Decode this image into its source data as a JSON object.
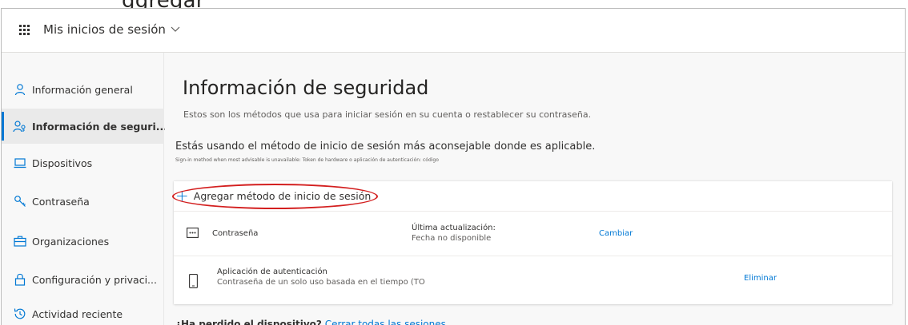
{
  "header_crop": "ggregar",
  "topbar": {
    "title": "Mis inicios de sesión"
  },
  "sidebar": {
    "items": [
      {
        "label": "Información general",
        "icon": "person-icon"
      },
      {
        "label": "Información de seguri...",
        "icon": "security-info-icon",
        "active": true
      },
      {
        "label": "Dispositivos",
        "icon": "laptop-icon"
      },
      {
        "label": "Contraseña",
        "icon": "key-icon"
      },
      {
        "label": "Organizaciones",
        "icon": "briefcase-icon"
      },
      {
        "label": "Configuración y privaci...",
        "icon": "lock-icon"
      },
      {
        "label": "Actividad reciente",
        "icon": "history-icon"
      }
    ]
  },
  "main": {
    "title": "Información de seguridad",
    "subtitle": "Estos son los métodos que usa para iniciar sesión en su cuenta o restablecer su contraseña.",
    "status": "Estás usando el método de inicio de sesión más aconsejable donde es aplicable.",
    "status_note": "Sign-in method when most advisable is unavailable: Token de hardware o aplicación de autenticación: código",
    "add_method": "Agregar método de inicio de sesión",
    "methods": [
      {
        "name": "Contraseña",
        "icon": "password-dots-icon",
        "detail_label": "Última actualización:",
        "detail_value": "Fecha no disponible",
        "action": "Cambiar"
      },
      {
        "name": "Aplicación de autenticación",
        "icon": "phone-icon",
        "detail": "Contraseña de un solo uso basada en el tiempo (TO",
        "action": "Eliminar"
      }
    ],
    "lost_device_question": "¿Ha perdido el dispositivo?",
    "lost_device_link": "Cerrar todas las sesiones"
  },
  "colors": {
    "accent": "#0078d4",
    "annotation": "#d31f1f"
  }
}
